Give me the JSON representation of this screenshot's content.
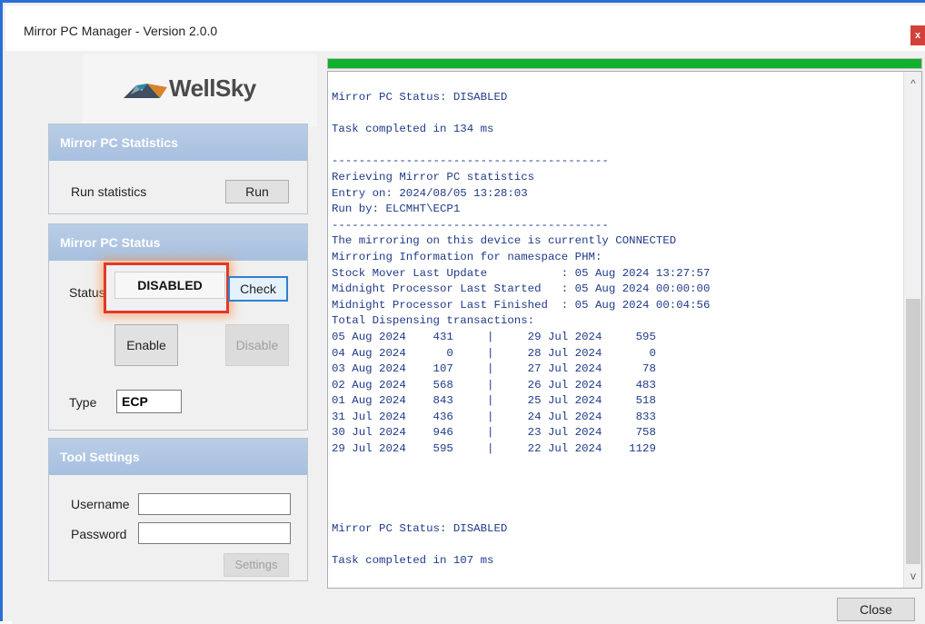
{
  "window": {
    "title": "Mirror PC Manager - Version 2.0.0",
    "close_glyph": "x"
  },
  "logo": {
    "text": "WellSky",
    "icon": "mountain-logo-icon",
    "colors": [
      "#d9832b",
      "#2a8aa8",
      "#3f4f5f"
    ]
  },
  "statistics_panel": {
    "title": "Mirror PC Statistics",
    "run_label": "Run statistics",
    "run_button": "Run"
  },
  "status_panel": {
    "title": "Mirror PC Status",
    "status_label": "Status",
    "status_value": "DISABLED",
    "check_button": "Check",
    "enable_button": "Enable",
    "disable_button": "Disable",
    "type_label": "Type",
    "type_value": "ECP"
  },
  "tool_settings_panel": {
    "title": "Tool Settings",
    "username_label": "Username",
    "password_label": "Password",
    "username_value": "",
    "password_value": "",
    "settings_button": "Settings"
  },
  "progress": {
    "percent": 100,
    "color": "#10b02c"
  },
  "log": {
    "text": "Mirror PC Status: DISABLED\n\nTask completed in 134 ms\n\n-----------------------------------------\nRerieving Mirror PC statistics\nEntry on: 2024/08/05 13:28:03\nRun by: ELCMHT\\ECP1\n-----------------------------------------\nThe mirroring on this device is currently CONNECTED\nMirroring Information for namespace PHM:\nStock Mover Last Update           : 05 Aug 2024 13:27:57\nMidnight Processor Last Started   : 05 Aug 2024 00:00:00\nMidnight Processor Last Finished  : 05 Aug 2024 00:04:56\nTotal Dispensing transactions:\n05 Aug 2024    431     |     29 Jul 2024     595\n04 Aug 2024      0     |     28 Jul 2024       0\n03 Aug 2024    107     |     27 Jul 2024      78\n02 Aug 2024    568     |     26 Jul 2024     483\n01 Aug 2024    843     |     25 Jul 2024     518\n31 Jul 2024    436     |     24 Jul 2024     833\n30 Jul 2024    946     |     23 Jul 2024     758\n29 Jul 2024    595     |     22 Jul 2024    1129\n\n\n\n\nMirror PC Status: DISABLED\n\nTask completed in 107 ms",
    "color": "#1f3a8a"
  },
  "scrollbar": {
    "up_glyph": "^",
    "down_glyph": "v"
  },
  "footer": {
    "close_button": "Close"
  }
}
